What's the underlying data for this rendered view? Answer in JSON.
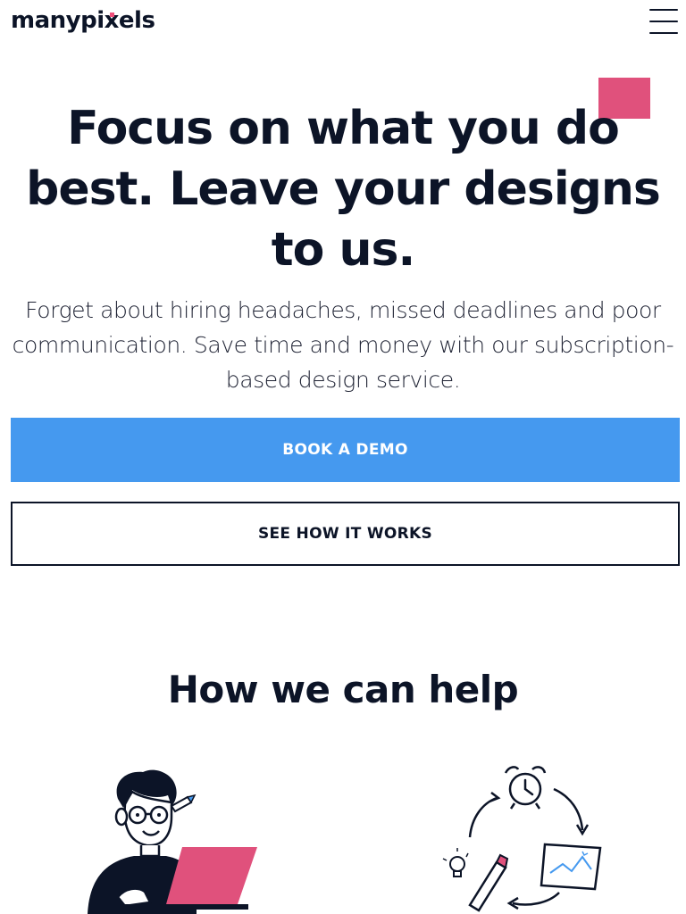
{
  "header": {
    "logo_text_a": "manypi",
    "logo_text_x": "x",
    "logo_text_b": "els",
    "menu_icon": "hamburger-menu-icon"
  },
  "hero": {
    "title": "Focus on what you do best. Leave your designs to us.",
    "subtitle": "Forget about hiring headaches, missed deadlines and poor communication. Save time and money with our subscription-based design service.",
    "primary_cta": "BOOK A DEMO",
    "secondary_cta": "SEE HOW IT WORKS"
  },
  "help": {
    "title": "How we can help",
    "illustrations": [
      "designer-with-laptop-illustration",
      "design-cycle-illustration"
    ]
  },
  "colors": {
    "navy": "#0c1427",
    "accent_pink": "#e0517c",
    "primary_blue": "#4599ef",
    "white": "#ffffff"
  }
}
